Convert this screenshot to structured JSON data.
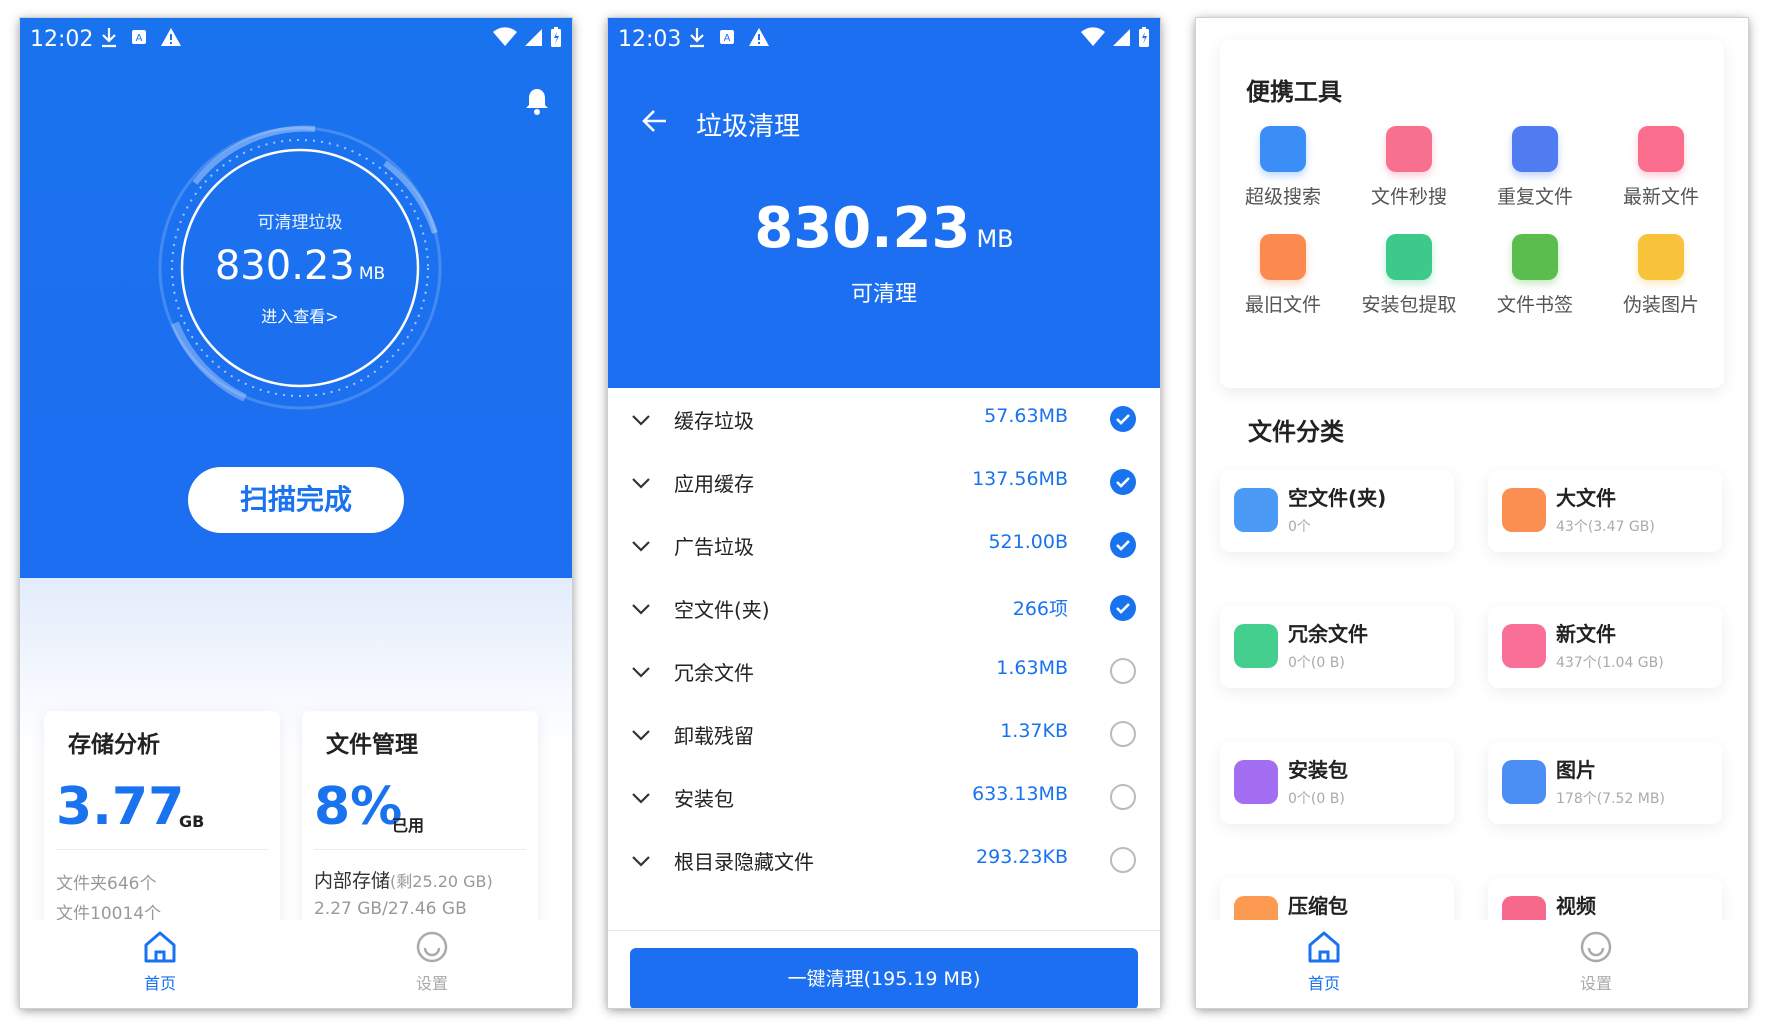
{
  "status": {
    "phone1_time": "12:02",
    "phone2_time": "12:03"
  },
  "home": {
    "gauge_label": "可清理垃圾",
    "gauge_value": "830.23",
    "gauge_unit": "MB",
    "enter_link": "进入查看>",
    "scan_button": "扫描完成",
    "storage_card": {
      "title": "存储分析",
      "value": "3.77",
      "unit": "GB",
      "folders": "文件夹646个",
      "files": "文件10014个"
    },
    "file_card": {
      "title": "文件管理",
      "value": "8%",
      "unit": "已用",
      "storage_label": "内部存储",
      "remaining": "(剩25.20 GB)",
      "usage": "2.27 GB/27.46 GB"
    }
  },
  "nav": {
    "home": "首页",
    "settings": "设置"
  },
  "cleanup": {
    "title": "垃圾清理",
    "total_value": "830.23",
    "total_unit": "MB",
    "total_caption": "可清理",
    "items": [
      {
        "label": "缓存垃圾",
        "value": "57.63MB",
        "checked": true
      },
      {
        "label": "应用缓存",
        "value": "137.56MB",
        "checked": true
      },
      {
        "label": "广告垃圾",
        "value": "521.00B",
        "checked": true
      },
      {
        "label": "空文件(夹)",
        "value": "266项",
        "checked": true
      },
      {
        "label": "冗余文件",
        "value": "1.63MB",
        "checked": false
      },
      {
        "label": "卸载残留",
        "value": "1.37KB",
        "checked": false
      },
      {
        "label": "安装包",
        "value": "633.13MB",
        "checked": false
      },
      {
        "label": "根目录隐藏文件",
        "value": "293.23KB",
        "checked": false
      }
    ],
    "clean_button": "一键清理(195.19 MB)"
  },
  "tools": {
    "section_title": "便携工具",
    "items": [
      {
        "label": "超级搜索",
        "color": "#3b8ef5"
      },
      {
        "label": "文件秒搜",
        "color": "#f7708f"
      },
      {
        "label": "重复文件",
        "color": "#4f7cf0"
      },
      {
        "label": "最新文件",
        "color": "#fb6d8c"
      },
      {
        "label": "最旧文件",
        "color": "#fa8a4f"
      },
      {
        "label": "安装包提取",
        "color": "#3cc98a"
      },
      {
        "label": "文件书签",
        "color": "#5bbd4e"
      },
      {
        "label": "伪装图片",
        "color": "#f8c23a"
      }
    ]
  },
  "categories": {
    "section_title": "文件分类",
    "items": [
      {
        "name": "空文件(夹)",
        "count": "0个",
        "color": "#4b9af6"
      },
      {
        "name": "大文件",
        "count": "43个(3.47 GB)",
        "color": "#fb8f52"
      },
      {
        "name": "冗余文件",
        "count": "0个(0 B)",
        "color": "#45cf8f"
      },
      {
        "name": "新文件",
        "count": "437个(1.04 GB)",
        "color": "#f96f97"
      },
      {
        "name": "安装包",
        "count": "0个(0 B)",
        "color": "#a36ef2"
      },
      {
        "name": "图片",
        "count": "178个(7.52 MB)",
        "color": "#4b8ff5"
      },
      {
        "name": "压缩包",
        "count": "",
        "color": "#fb9a50"
      },
      {
        "name": "视频",
        "count": "",
        "color": "#f7698b"
      }
    ]
  }
}
